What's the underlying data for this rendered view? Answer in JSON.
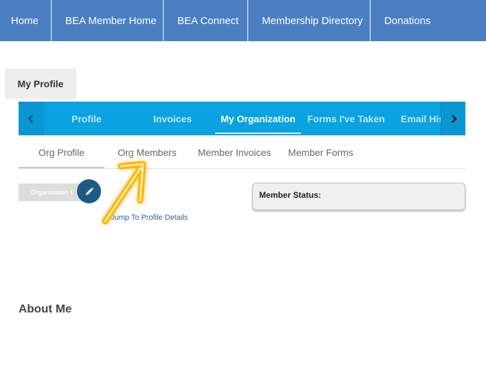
{
  "topnav": {
    "items": [
      "Home",
      "BEA Member Home",
      "BEA Connect",
      "Membership Directory",
      "Donations"
    ]
  },
  "profile_tab": {
    "label": "My Profile"
  },
  "tabstrip": {
    "tabs": [
      "Profile",
      "Invoices",
      "My Organization",
      "Forms I've Taken",
      "Email His"
    ],
    "active": "My Organization"
  },
  "subtabs": {
    "items": [
      "Org Profile",
      "Org Members",
      "Member Invoices",
      "Member Forms"
    ],
    "active": "Org Profile"
  },
  "org": {
    "logo_text": "Organization L",
    "jump_link": "Jump To Profile Details"
  },
  "status": {
    "label": "Member Status:"
  },
  "about": {
    "heading": "About Me"
  },
  "colors": {
    "topnav": "#4a80c2",
    "tabstrip": "#0aa2e0",
    "edit_button": "#1e5b84",
    "annotation": "#ffb400"
  },
  "icons": [
    "chevron-left-icon",
    "chevron-right-icon",
    "pencil-icon",
    "annotation-arrow-icon"
  ]
}
